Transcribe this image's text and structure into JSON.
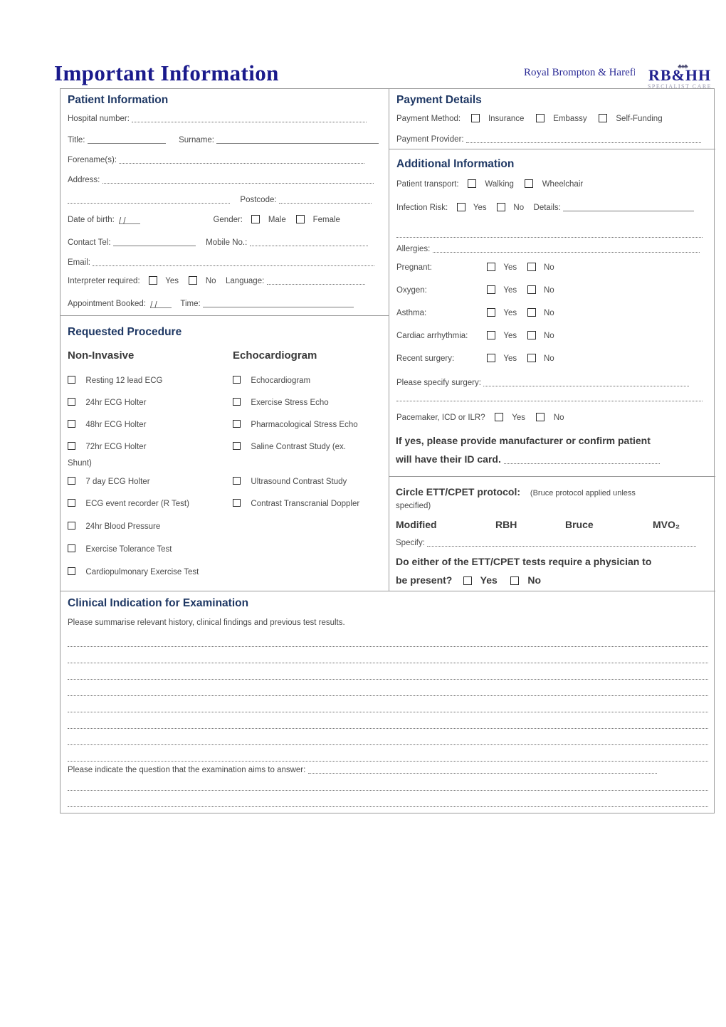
{
  "header": {
    "title": "Important Information",
    "org": "Royal Brompton & Harefield",
    "logo_main": "RB&HH",
    "logo_sub": "SPECIALIST CARE",
    "logo_crown": "crown"
  },
  "patient_information": {
    "heading": "Patient Information",
    "hospital_number_label": "Hospital number:",
    "title_label": "Title:",
    "surname_label": "Surname:",
    "forenames_label": "Forename(s):",
    "address_label": "Address:",
    "postcode_label": "Postcode:",
    "dob_label": "Date of birth:",
    "dob_value": "/  /",
    "gender_label": "Gender:",
    "gender_options": [
      "Male",
      "Female"
    ],
    "contact_tel_label": "Contact Tel:",
    "mobile_label": "Mobile No.:",
    "email_label": "Email:",
    "interpreter_label": "Interpreter required:",
    "interpreter_options": [
      "Yes",
      "No"
    ],
    "language_label": "Language:",
    "appointment_label": "Appointment Booked:",
    "appointment_value": "/  /",
    "time_label": "Time:"
  },
  "payment_details": {
    "heading": "Payment Details",
    "method_label": "Payment Method:",
    "method_options": [
      "Insurance",
      "Embassy",
      "Self-Funding"
    ],
    "provider_label": "Payment Provider:"
  },
  "additional_information": {
    "heading": "Additional Information",
    "transport_label": "Patient transport:",
    "transport_options": [
      "Walking",
      "Wheelchair"
    ],
    "infection_label": "Infection Risk:",
    "infection_options": [
      "Yes",
      "No"
    ],
    "infection_details_label": "Details:",
    "allergies_label": "Allergies:",
    "yesno_rows": [
      {
        "label": "Pregnant:",
        "yes": "Yes",
        "no": "No"
      },
      {
        "label": "Oxygen:",
        "yes": "Yes",
        "no": "No"
      },
      {
        "label": "Asthma:",
        "yes": "Yes",
        "no": "No"
      },
      {
        "label": "Cardiac arrhythmia:",
        "yes": "Yes",
        "no": "No"
      },
      {
        "label": "Recent surgery:",
        "yes": "Yes",
        "no": "No"
      }
    ],
    "specify_surgery_label": "Please specify surgery:",
    "pacemaker_label": "Pacemaker, ICD or ILR?",
    "pacemaker_options": [
      "Yes",
      "No"
    ],
    "pacemaker_note_line1": "If yes, please provide manufacturer or confirm patient",
    "pacemaker_note_line2": "will have their ID card."
  },
  "ett_cpet": {
    "heading": "Circle ETT/CPET protocol:",
    "heading_note_line1": "(Bruce protocol applied unless",
    "heading_note_line2": "specified)",
    "protocols": [
      "Modified",
      "RBH",
      "Bruce",
      "MVO₂"
    ],
    "specify_label": "Specify:",
    "physician_question_line1": "Do either of the ETT/CPET tests require a physician to",
    "physician_question_line2": "be present?",
    "physician_options": [
      "Yes",
      "No"
    ]
  },
  "requested_procedure": {
    "heading": "Requested Procedure",
    "col1_heading": "Non-Invasive",
    "col2_heading": "Echocardiogram",
    "col1_items": [
      "Resting 12 lead ECG",
      "24hr ECG Holter",
      "48hr ECG Holter",
      "72hr ECG Holter",
      "7 day ECG Holter",
      "ECG event recorder (R Test)",
      "24hr Blood Pressure",
      "Exercise Tolerance Test",
      "Cardiopulmonary Exercise Test"
    ],
    "col2_items": [
      "Echocardiogram",
      "Exercise Stress Echo",
      "Pharmacological Stress Echo",
      "Saline Contrast Study (ex.",
      "Ultrasound Contrast Study",
      "Contrast Transcranial Doppler"
    ],
    "wrap_text": "Shunt)"
  },
  "clinical_indication": {
    "heading": "Clinical Indication for Examination",
    "instruction": "Please summarise relevant history, clinical findings and previous test results.",
    "question_label": "Please indicate the question that the examination aims to answer:"
  },
  "colors": {
    "heading_blue": "#1f3864",
    "title_blue": "#1a1a8c",
    "border_gray": "#9b9b9b",
    "text_gray": "#4a4a4a"
  }
}
